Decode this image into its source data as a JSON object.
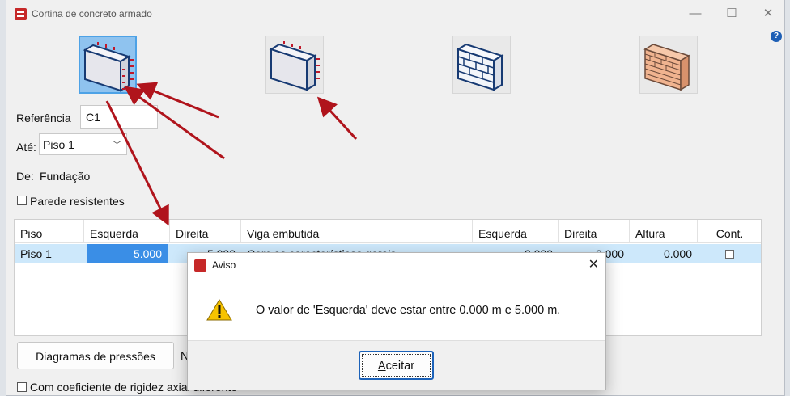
{
  "window": {
    "title": "Cortina de concreto armado",
    "minimize": "—",
    "maximize": "☐",
    "close": "✕",
    "help": "?"
  },
  "wall_types": [
    {
      "name": "concrete-wall-both-sides",
      "selected": true
    },
    {
      "name": "concrete-wall-one-side",
      "selected": false
    },
    {
      "name": "block-masonry-wall",
      "selected": false
    },
    {
      "name": "brick-masonry-wall",
      "selected": false
    }
  ],
  "form": {
    "referencia_label": "Referência",
    "referencia_value": "C1",
    "ate_label": "Até:",
    "ate_value": "Piso 1",
    "de_label": "De:",
    "de_value": "Fundação",
    "parede_label": "Parede resistentes"
  },
  "table": {
    "headers": [
      "Piso",
      "Esquerda",
      "Direita",
      "Viga embutida",
      "Esquerda",
      "Direita",
      "Altura",
      "Cont."
    ],
    "row": {
      "piso": "Piso 1",
      "esquerda": "5.000",
      "direita": "5.000",
      "viga": "Com as características gerais",
      "esquerda2": "0.000",
      "direita2": "0.000",
      "altura": "0.000"
    }
  },
  "bottom": {
    "diagramas": "Diagramas de pressões",
    "partial": "N",
    "rigidez_label": "Com coeficiente de rigidez axial diferente"
  },
  "dialog": {
    "title": "Aviso",
    "close": "✕",
    "message": "O valor de 'Esquerda' deve estar entre 0.000 m e 5.000 m.",
    "ok_prefix": "A",
    "ok_rest": "ceitar"
  },
  "colors": {
    "accent": "#3a8ee6",
    "selected_row": "#cde8fb",
    "arrow": "#b0141c"
  }
}
